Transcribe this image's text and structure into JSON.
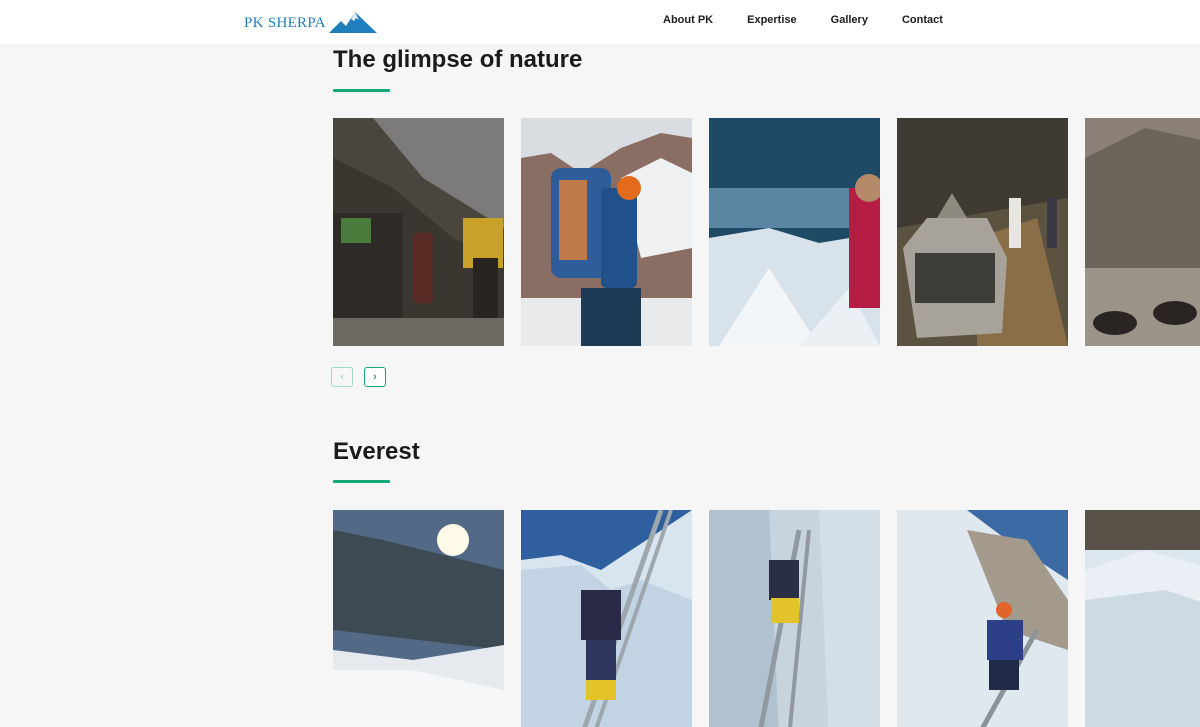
{
  "header": {
    "logo_text": "PK SHERPA",
    "nav": [
      "About PK",
      "Expertise",
      "Gallery",
      "Contact"
    ]
  },
  "sections": [
    {
      "title": "The glimpse of nature",
      "photos": [
        "porters-with-backpacks",
        "climber-with-blue-pack",
        "mountaineer-above-clouds",
        "mani-stone-and-trekkers",
        "yaks-on-trail"
      ]
    },
    {
      "title": "Everest",
      "photos": [
        "sun-over-glacier",
        "climber-on-ladder-icefall",
        "ladder-in-crevasse",
        "climber-crossing-ladder",
        "icefall-seracs"
      ]
    }
  ],
  "carousel": {
    "prev_icon": "‹",
    "next_icon": "›"
  },
  "colors": {
    "accent": "#17a67a",
    "logo_blue": "#1f7fbd",
    "background": "#f6f6f6"
  }
}
